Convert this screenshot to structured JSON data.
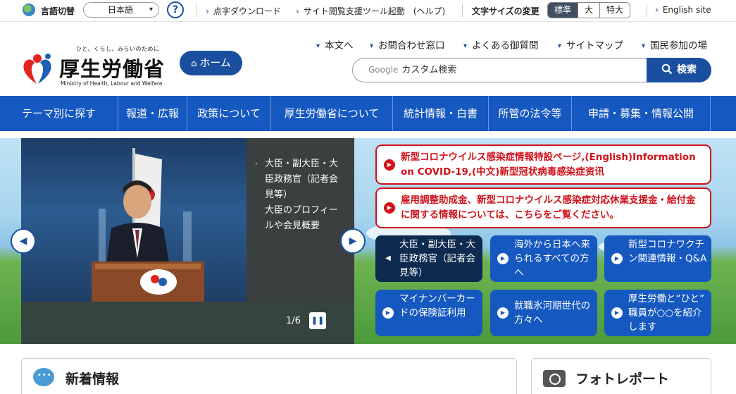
{
  "utility": {
    "lang_label": "言語切替",
    "lang_value": "日本語",
    "help": "?",
    "links": [
      "点字ダウンロード",
      "サイト閲覧支援ツール起動　(ヘルプ)"
    ],
    "font_size_label": "文字サイズの変更",
    "font_sizes": [
      "標準",
      "大",
      "特大"
    ],
    "english": "English site"
  },
  "header": {
    "tagline": "ひと、くらし、みらいのために",
    "org_name": "厚生労働省",
    "org_name_en": "Ministry of Health, Labour and Welfare",
    "home_label": "ホーム",
    "links": [
      "本文へ",
      "お問合わせ窓口",
      "よくある御質問",
      "サイトマップ",
      "国民参加の場"
    ],
    "search_brand": "Google",
    "search_placeholder": "カスタム検索",
    "search_button": "検索"
  },
  "nav": [
    "テーマ別に探す",
    "報道・広報",
    "政策について",
    "厚生労働省について",
    "統計情報・白書",
    "所管の法令等",
    "申請・募集・情報公開"
  ],
  "slider": {
    "caption1": "大臣・副大臣・大臣政務官（記者会見等）",
    "caption2": "大臣のプロフィールや会見概要",
    "counter": "1/6"
  },
  "alerts": [
    "新型コロナウイルス感染症情報特設ページ,(English)Information on COVID-19,(中文)新型冠状病毒感染症资讯",
    "雇用調整助成金、新型コロナウイルス感染症対応休業支援金・給付金に関する情報については、こちらをご覧ください。"
  ],
  "tiles": [
    "大臣・副大臣・大臣政務官（記者会見等）",
    "海外から日本へ来られるすべての方へ",
    "新型コロナワクチン関連情報・Q&A",
    "マイナンバーカードの保険証利用",
    "就職氷河期世代の方々へ",
    "厚生労働と“ひと” 職員が○○を紹介します"
  ],
  "sections": {
    "news": "新着情報",
    "photo": "フォトレポート"
  },
  "colors": {
    "brand_blue": "#1558c0",
    "alert_red": "#d0121b",
    "dark_tile": "#0e2a4f"
  }
}
